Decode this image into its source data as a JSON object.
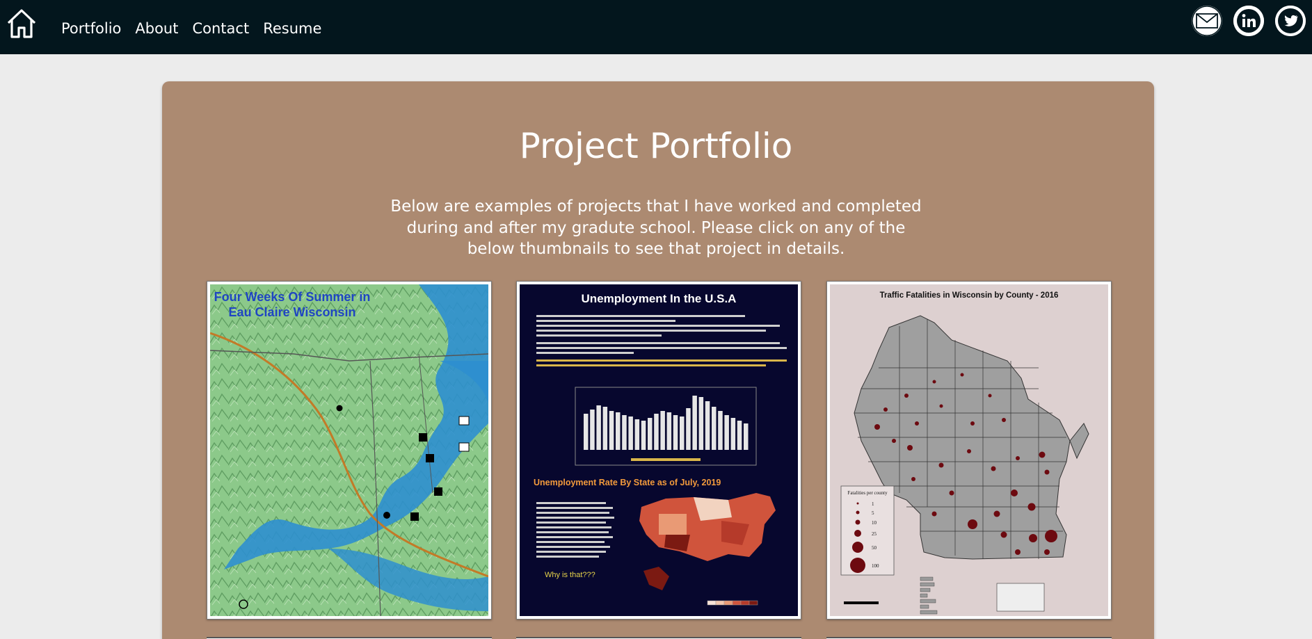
{
  "nav": {
    "home_icon": "home-icon",
    "links": [
      "Portfolio",
      "About",
      "Contact",
      "Resume"
    ],
    "social": [
      {
        "name": "email",
        "icon": "mail-icon"
      },
      {
        "name": "linkedin",
        "icon": "linkedin-icon"
      },
      {
        "name": "twitter",
        "icon": "twitter-icon"
      }
    ]
  },
  "colors": {
    "nav_bg": "#03161d",
    "page_bg": "#ececec",
    "panel_bg": "#ac8a71",
    "text": "#ffffff"
  },
  "main": {
    "title": "Project Portfolio",
    "intro": "Below are examples of projects that I have worked and completed during and after my gradute school. Please click on any of the below thumbnails to see that project in details."
  },
  "thumbnails": [
    {
      "title_line1": "Four Weeks Of Summer in",
      "title_line2": "Eau Claire Wisconsin"
    },
    {
      "title": "Unemployment In the U.S.A",
      "subtitle": "Unemployment Rate By State as of July, 2019",
      "question": "Why is that???"
    },
    {
      "title": "Traffic Fatalities in Wisconsin by County - 2016",
      "legend_title": "Fatalities per county",
      "legend_values": [
        "1",
        "5",
        "10",
        "25",
        "50",
        "100"
      ]
    }
  ]
}
